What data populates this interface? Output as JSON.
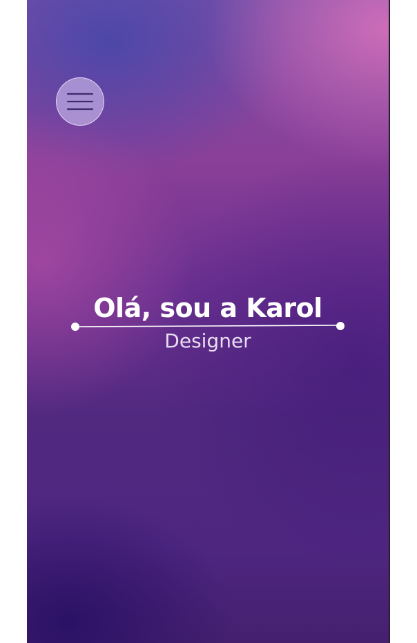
{
  "hero": {
    "title": "Olá, sou a Karol",
    "subtitle": "Designer"
  },
  "menu": {
    "icon": "hamburger-menu-icon"
  },
  "colors": {
    "accent_gradient_top": "#7a4fa8",
    "accent_gradient_bottom": "#45206f",
    "text_primary": "#ffffff",
    "text_secondary": "#e8ddf2",
    "menu_icon": "#3e2a6e"
  }
}
